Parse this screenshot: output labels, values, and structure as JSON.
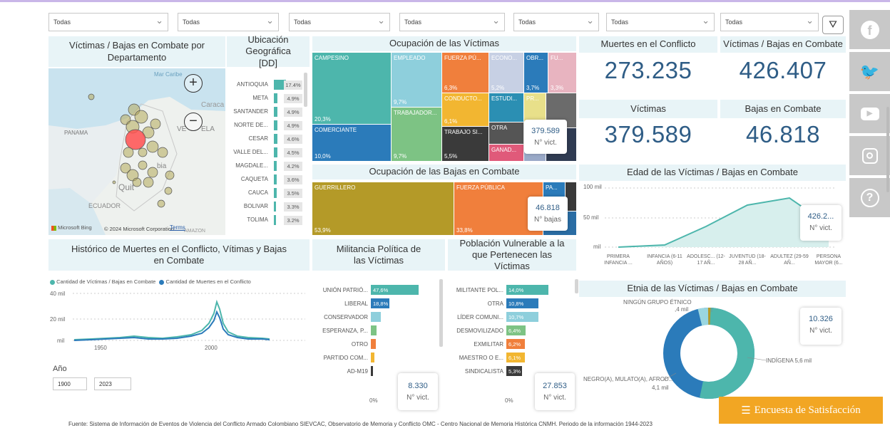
{
  "filters": [
    {
      "value": "Todas"
    },
    {
      "value": "Todas"
    },
    {
      "value": "Todas"
    },
    {
      "value": "Todas"
    },
    {
      "value": "Todas"
    },
    {
      "value": "Todas"
    },
    {
      "value": "Todas"
    }
  ],
  "map": {
    "title": "Víctimas / Bajas en Combate por Departamento",
    "labels": [
      "Mar Caribe",
      "Caraca",
      "PANAMA",
      "VE",
      "ELA",
      "ecuador_lbl",
      "ECUADOR",
      "Quit",
      "bia",
      "mbia",
      "AMAZON"
    ],
    "zoom_in": "+",
    "zoom_out": "−",
    "bing": "Microsoft Bing",
    "copyright": "© 2024 Microsoft Corporation",
    "terms": "Terms"
  },
  "ubicacion": {
    "title": "Ubicación Geográfica [DD]",
    "rows": [
      {
        "name": "ANTIOQUIA",
        "pct": "17.4%",
        "fill": 0.174
      },
      {
        "name": "META",
        "pct": "4.9%",
        "fill": 0.049
      },
      {
        "name": "SANTANDER",
        "pct": "4.9%",
        "fill": 0.049
      },
      {
        "name": "NORTE DE...",
        "pct": "4.9%",
        "fill": 0.049
      },
      {
        "name": "CESAR",
        "pct": "4.6%",
        "fill": 0.046
      },
      {
        "name": "VALLE DEL...",
        "pct": "4.5%",
        "fill": 0.045
      },
      {
        "name": "MAGDALE...",
        "pct": "4.2%",
        "fill": 0.042
      },
      {
        "name": "CAQUETA",
        "pct": "3.6%",
        "fill": 0.036
      },
      {
        "name": "CAUCA",
        "pct": "3.5%",
        "fill": 0.035
      },
      {
        "name": "BOLIVAR",
        "pct": "3.3%",
        "fill": 0.033
      },
      {
        "name": "TOLIMA",
        "pct": "3.2%",
        "fill": 0.032
      }
    ]
  },
  "ocupacion_victimas": {
    "title": "Ocupación de las Víctimas",
    "cells": [
      {
        "name": "CAMPESINO",
        "pct": "20,3%"
      },
      {
        "name": "COMERCIANTE",
        "pct": "10,0%"
      },
      {
        "name": "EMPLEADO",
        "pct": "9,7%"
      },
      {
        "name": "TRABAJADOR...",
        "pct": "9,7%"
      },
      {
        "name": "FUERZA PÚ...",
        "pct": "6,3%"
      },
      {
        "name": "CONDUCTO...",
        "pct": "6,1%"
      },
      {
        "name": "TRABAJO SI...",
        "pct": "5,5%"
      },
      {
        "name": "ECONO...",
        "pct": "5,2%"
      },
      {
        "name": "ESTUDI...",
        "pct": ""
      },
      {
        "name": "OTRA",
        "pct": ""
      },
      {
        "name": "GANAD...",
        "pct": ""
      },
      {
        "name": "OBR...",
        "pct": "3,7%"
      },
      {
        "name": "FU...",
        "pct": "3,3%"
      },
      {
        "name": "PR...",
        "pct": ""
      }
    ],
    "tip_value": "379.589",
    "tip_label": "N° vict."
  },
  "ocupacion_bajas": {
    "title": "Ocupación de las Bajas en Combate",
    "cells": [
      {
        "name": "GUERRILLERO",
        "pct": "53,9%"
      },
      {
        "name": "FUERZA PÚBLICA",
        "pct": "33,8%"
      },
      {
        "name": "PA...",
        "pct": ""
      }
    ],
    "tip_value": "46.818",
    "tip_label": "N° bajas"
  },
  "kpis": {
    "muertes_title": "Muertes en el Conflicto",
    "muertes_value": "273.235",
    "vb_title": "Víctimas / Bajas en Combate",
    "vb_value": "426.407",
    "victimas_title": "Víctimas",
    "victimas_value": "379.589",
    "bajas_title": "Bajas en Combate",
    "bajas_value": "46.818"
  },
  "edad": {
    "title": "Edad de las Víctimas / Bajas en Combate",
    "yticks": [
      "100 mil",
      "50 mil",
      "mil"
    ],
    "categories": [
      "PRIMERA INFANCIA ...",
      "INFANCIA (6-11 AÑOS)",
      "ADOLESC... (12-17 AÑ...",
      "JUVENTUD (18-28 AÑ...",
      "ADULTEZ (29-59 AÑ...",
      "PERSONA MAYOR (6..."
    ],
    "tip_value": "426.2...",
    "tip_label": "N° vict."
  },
  "historico": {
    "title": "Histórico de Muertes en el Conflicto, Vítimas y Bajas en Combate",
    "legend": [
      "Cantidad de Víctimas / Bajas en Combate",
      "Cantidad de Muertes en el Conflicto"
    ],
    "yticks": [
      "40 mil",
      "20 mil",
      "mil"
    ],
    "xticks": [
      "1950",
      "2000"
    ],
    "anio_label": "Año",
    "anio_from": "1900",
    "anio_to": "2023"
  },
  "militancia": {
    "title": "Militancia Política de las Víctimas",
    "rows": [
      {
        "name": "UNIÓN PATRIÓ...",
        "pct": "47,6%",
        "fill": 0.476
      },
      {
        "name": "LIBERAL",
        "pct": "18,8%",
        "fill": 0.188
      },
      {
        "name": "CONSERVADOR",
        "pct": "",
        "fill": 0.1
      },
      {
        "name": "ESPERANZA, P...",
        "pct": "",
        "fill": 0.06
      },
      {
        "name": "OTRO",
        "pct": "",
        "fill": 0.05
      },
      {
        "name": "PARTIDO COM...",
        "pct": "",
        "fill": 0.035
      },
      {
        "name": "AD-M19",
        "pct": "",
        "fill": 0.01
      }
    ],
    "axis_zero": "0%",
    "tip_value": "8.330",
    "tip_label": "N° vict."
  },
  "vulnerable": {
    "title": "Población Vulnerable a la que Pertenecen las Víctimas",
    "rows": [
      {
        "name": "MILITANTE POL...",
        "pct": "14,0%",
        "fill": 0.14
      },
      {
        "name": "OTRA",
        "pct": "10,8%",
        "fill": 0.108
      },
      {
        "name": "LÍDER COMUNI...",
        "pct": "10,7%",
        "fill": 0.107
      },
      {
        "name": "DESMOVILIZADO",
        "pct": "6,4%",
        "fill": 0.064
      },
      {
        "name": "EXMILITAR",
        "pct": "6,2%",
        "fill": 0.062
      },
      {
        "name": "MAESTRO O E...",
        "pct": "6,1%",
        "fill": 0.061
      },
      {
        "name": "SINDICALISTA",
        "pct": "5,3%",
        "fill": 0.053
      }
    ],
    "axis_zero": "0%",
    "tip_value": "27.853",
    "tip_label": "N° vict."
  },
  "etnia": {
    "title": "Etnia de las Víctimas / Bajas en Combate",
    "label_ninguno": "NINGÚN GRUPO ÉTNICO",
    "label_ninguno_val": ",4 mil",
    "label_indigena": "INDÍGENA 5,6 mil",
    "label_negro": "NEGRO(A), MULATO(A), AFROD...",
    "label_negro_val": "4,1 mil",
    "tip_value": "10.326",
    "tip_label": "N° vict."
  },
  "footer": "Fuente: Sistema de Información de Eventos de Violencia del Conflicto Armado Colombiano SIEVCAC, Observatorio de Memoria y Conflicto OMC - Centro Nacional de Memoria Histórica CNMH. Periodo de la información 1944-2023",
  "encuesta": "Encuesta de Satisfacción",
  "colors": {
    "teal": "#4db6ac",
    "blue": "#2b7bba",
    "orange": "#f07f3c",
    "olive": "#b49a28",
    "kpi": "#2f5d86"
  }
}
